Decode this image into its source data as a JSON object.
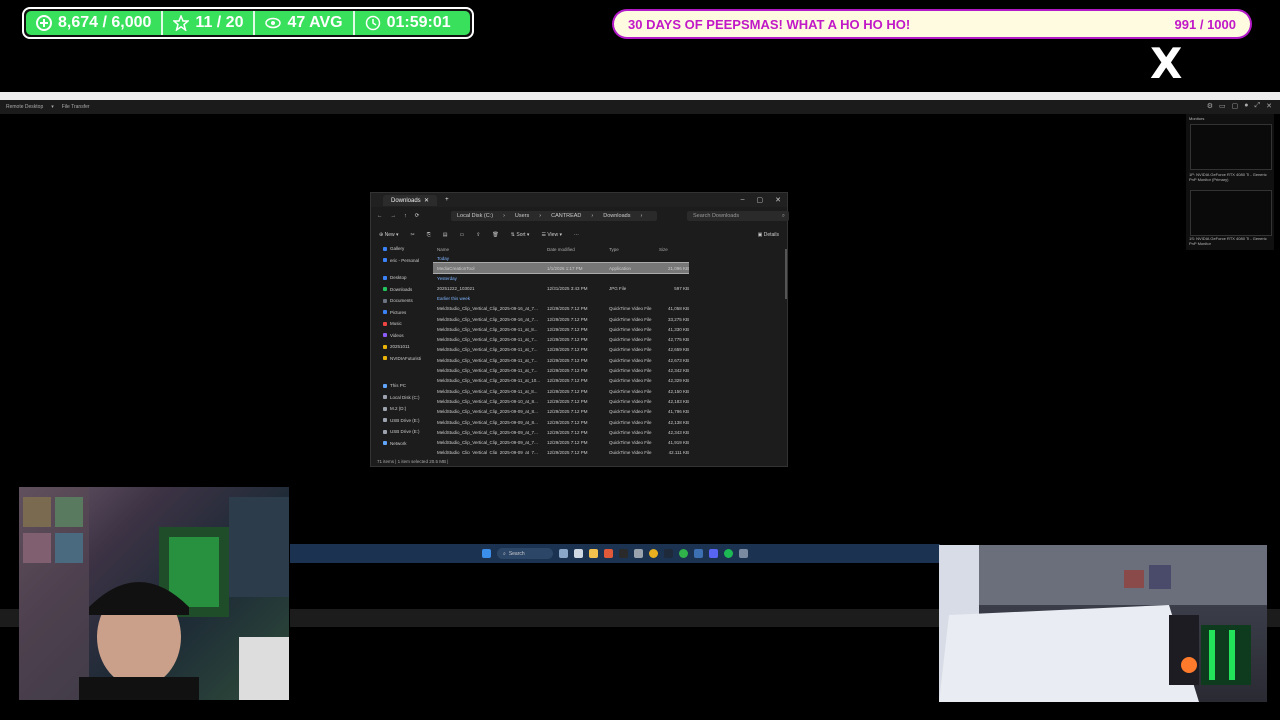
{
  "overlay": {
    "followers": "8,674 / 6,000",
    "stars": "11 / 20",
    "viewers": "47 AVG",
    "timer": "01:59:01",
    "banner_text": "30 DAYS OF PEEPSMAS! WHAT A HO HO HO!",
    "banner_count": "991 / 1000",
    "brand_color": "#38e05b",
    "banner_border": "#b319c9",
    "social_logo": "X"
  },
  "remote_desktop": {
    "mode_label": "Remote Desktop",
    "file_transfer": "File Transfer",
    "monitors_title": "Monitors",
    "monitor1_label": "1P: NVIDIA GeForce RTX 4080 Ti - Generic PnP Monitor (Primary)",
    "monitor2_label": "1S: NVIDIA GeForce RTX 4080 Ti - Generic PnP Monitor"
  },
  "explorer": {
    "tab_title": "Downloads",
    "path": [
      "Local Disk (C:)",
      "Users",
      "CANTREAD",
      "Downloads"
    ],
    "search_placeholder": "Search Downloads",
    "cmd": {
      "new": "New",
      "sort": "Sort",
      "view": "View",
      "details": "Details"
    },
    "sidebar": [
      {
        "label": "Gallery",
        "color": "#3b82f6"
      },
      {
        "label": "eric - Personal",
        "color": "#3b82f6"
      },
      {
        "label": "Desktop",
        "color": "#3b82f6"
      },
      {
        "label": "Downloads",
        "color": "#22c55e"
      },
      {
        "label": "Documents",
        "color": "#6b7280"
      },
      {
        "label": "Pictures",
        "color": "#3b82f6"
      },
      {
        "label": "Music",
        "color": "#ef4444"
      },
      {
        "label": "Videos",
        "color": "#8b5cf6"
      },
      {
        "label": "20251011",
        "color": "#eab308"
      },
      {
        "label": "NVIDIAFuturisti",
        "color": "#eab308"
      },
      {
        "label": "This PC",
        "color": "#60a5fa"
      },
      {
        "label": "Local Disk (C:)",
        "color": "#9ca3af"
      },
      {
        "label": "M.2 (D:)",
        "color": "#9ca3af"
      },
      {
        "label": "USB Drive (E:)",
        "color": "#9ca3af"
      },
      {
        "label": "USB Drive (E:)",
        "color": "#9ca3af"
      },
      {
        "label": "Network",
        "color": "#60a5fa"
      }
    ],
    "columns": [
      "Name",
      "Date modified",
      "Type",
      "Size"
    ],
    "groups": {
      "today": "Today",
      "yesterday": "Yesterday",
      "earlier": "Earlier this week"
    },
    "today_rows": [
      {
        "name": "MediaCreationTool",
        "date": "1/1/2026 1:17 PM",
        "type": "Application",
        "size": "21,096 KB"
      }
    ],
    "yesterday_rows": [
      {
        "name": "20251222_103021",
        "date": "12/31/2025 3:43 PM",
        "type": "JPG File",
        "size": "597 KB"
      }
    ],
    "earlier_rows": [
      {
        "name": "MeldStudio_Clip_Vertical_Clip_2025-09-16_at_7...",
        "date": "12/29/2025 7:12 PM",
        "type": "QuickTime Video File",
        "size": "41,058 KB"
      },
      {
        "name": "MeldStudio_Clip_Vertical_Clip_2025-09-16_at_7...",
        "date": "12/29/2025 7:12 PM",
        "type": "QuickTime Video File",
        "size": "33,275 KB"
      },
      {
        "name": "MeldStudio_Clip_Vertical_Clip_2025-09-11_at_8...",
        "date": "12/29/2025 7:12 PM",
        "type": "QuickTime Video File",
        "size": "41,330 KB"
      },
      {
        "name": "MeldStudio_Clip_Vertical_Clip_2025-09-11_at_7...",
        "date": "12/29/2025 7:12 PM",
        "type": "QuickTime Video File",
        "size": "42,775 KB"
      },
      {
        "name": "MeldStudio_Clip_Vertical_Clip_2025-09-11_at_7...",
        "date": "12/29/2025 7:12 PM",
        "type": "QuickTime Video File",
        "size": "42,659 KB"
      },
      {
        "name": "MeldStudio_Clip_Vertical_Clip_2025-09-11_at_7...",
        "date": "12/29/2025 7:12 PM",
        "type": "QuickTime Video File",
        "size": "42,673 KB"
      },
      {
        "name": "MeldStudio_Clip_Vertical_Clip_2025-09-11_at_7...",
        "date": "12/29/2025 7:12 PM",
        "type": "QuickTime Video File",
        "size": "42,342 KB"
      },
      {
        "name": "MeldStudio_Clip_Vertical_Clip_2025-09-11_at_10...",
        "date": "12/29/2025 7:12 PM",
        "type": "QuickTime Video File",
        "size": "42,329 KB"
      },
      {
        "name": "MeldStudio_Clip_Vertical_Clip_2025-09-11_at_8...",
        "date": "12/29/2025 7:12 PM",
        "type": "QuickTime Video File",
        "size": "42,150 KB"
      },
      {
        "name": "MeldStudio_Clip_Vertical_Clip_2025-09-10_at_8...",
        "date": "12/29/2025 7:12 PM",
        "type": "QuickTime Video File",
        "size": "42,183 KB"
      },
      {
        "name": "MeldStudio_Clip_Vertical_Clip_2025-09-09_at_8...",
        "date": "12/29/2025 7:12 PM",
        "type": "QuickTime Video File",
        "size": "41,796 KB"
      },
      {
        "name": "MeldStudio_Clip_Vertical_Clip_2025-09-09_at_8...",
        "date": "12/29/2025 7:12 PM",
        "type": "QuickTime Video File",
        "size": "42,138 KB"
      },
      {
        "name": "MeldStudio_Clip_Vertical_Clip_2025-09-09_at_7...",
        "date": "12/29/2025 7:12 PM",
        "type": "QuickTime Video File",
        "size": "42,343 KB"
      },
      {
        "name": "MeldStudio_Clip_Vertical_Clip_2025-09-09_at_7...",
        "date": "12/29/2025 7:12 PM",
        "type": "QuickTime Video File",
        "size": "41,919 KB"
      },
      {
        "name": "MeldStudio_Clip_Vertical_Clip_2025-09-09_at_7...",
        "date": "12/29/2025 7:12 PM",
        "type": "QuickTime Video File",
        "size": "42,111 KB"
      }
    ],
    "status": "71 items  |  1 item selected  20.5 MB  |"
  },
  "taskbar": {
    "search_label": "Search"
  }
}
